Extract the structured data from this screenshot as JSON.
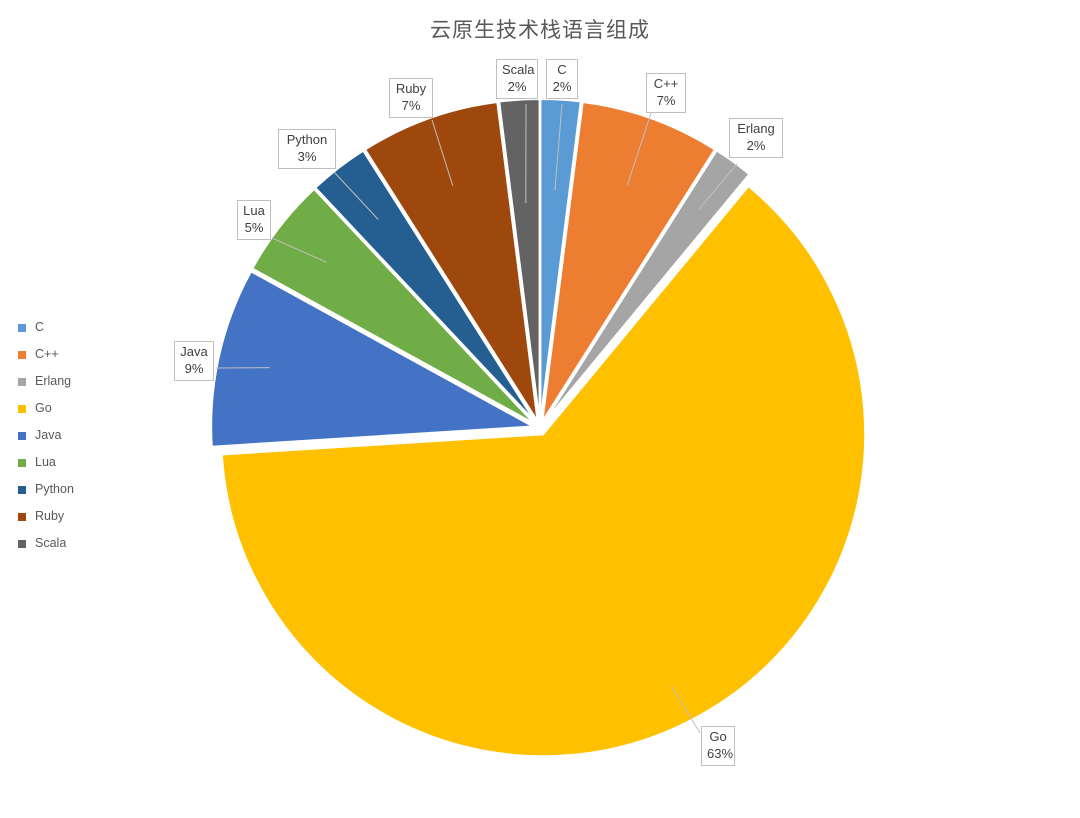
{
  "chart_data": {
    "type": "pie",
    "title": "云原生技术栈语言组成",
    "xlabel": "",
    "ylabel": "",
    "legend_position": "left",
    "grid": false,
    "value_unit": "%",
    "categories": [
      "C",
      "C++",
      "Erlang",
      "Go",
      "Java",
      "Lua",
      "Python",
      "Ruby",
      "Scala"
    ],
    "values": [
      2,
      7,
      2,
      63,
      9,
      5,
      3,
      7,
      2
    ],
    "colors": [
      "#5B9BD5",
      "#ED7D31",
      "#A5A5A5",
      "#FFC000",
      "#4472C4",
      "#70AD47",
      "#255E91",
      "#9E480E",
      "#636363"
    ],
    "slice_order": [
      "C",
      "C++",
      "Erlang",
      "Go",
      "Java",
      "Lua",
      "Python",
      "Ruby",
      "Scala"
    ],
    "data_labels": [
      {
        "name": "C",
        "value": "2%"
      },
      {
        "name": "C++",
        "value": "7%"
      },
      {
        "name": "Erlang",
        "value": "2%"
      },
      {
        "name": "Go",
        "value": "63%"
      },
      {
        "name": "Java",
        "value": "9%"
      },
      {
        "name": "Lua",
        "value": "5%"
      },
      {
        "name": "Python",
        "value": "3%"
      },
      {
        "name": "Ruby",
        "value": "7%"
      },
      {
        "name": "Scala",
        "value": "2%"
      }
    ]
  },
  "title": {
    "text": "云原生技术栈语言组成"
  },
  "legend": {
    "items": [
      {
        "label": "C",
        "color": "#5B9BD5"
      },
      {
        "label": "C++",
        "color": "#ED7D31"
      },
      {
        "label": "Erlang",
        "color": "#A5A5A5"
      },
      {
        "label": "Go",
        "color": "#FFC000"
      },
      {
        "label": "Java",
        "color": "#4472C4"
      },
      {
        "label": "Lua",
        "color": "#70AD47"
      },
      {
        "label": "Python",
        "color": "#255E91"
      },
      {
        "label": "Ruby",
        "color": "#9E480E"
      },
      {
        "label": "Scala",
        "color": "#636363"
      }
    ]
  },
  "callouts": {
    "scala": {
      "name": "Scala",
      "value": "2%"
    },
    "c": {
      "name": "C",
      "value": "2%"
    },
    "cpp": {
      "name": "C++",
      "value": "7%"
    },
    "erlang": {
      "name": "Erlang",
      "value": "2%"
    },
    "ruby": {
      "name": "Ruby",
      "value": "7%"
    },
    "python": {
      "name": "Python",
      "value": "3%"
    },
    "lua": {
      "name": "Lua",
      "value": "5%"
    },
    "java": {
      "name": "Java",
      "value": "9%"
    },
    "go": {
      "name": "Go",
      "value": "63%"
    }
  }
}
